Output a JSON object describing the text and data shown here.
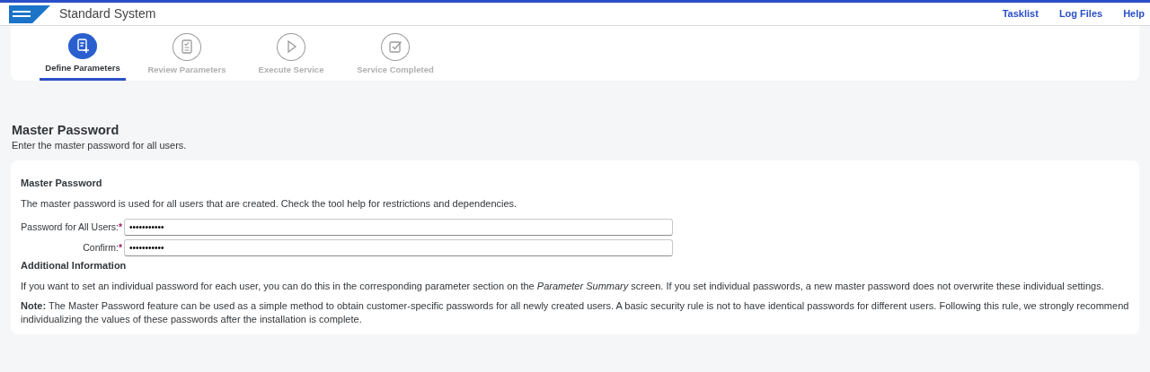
{
  "header": {
    "title": "Standard System",
    "links": [
      "Tasklist",
      "Log Files",
      "Help"
    ]
  },
  "steps": [
    {
      "label": "Define Parameters",
      "kind": "define",
      "selected": true
    },
    {
      "label": "Review Parameters",
      "kind": "review",
      "selected": false
    },
    {
      "label": "Execute Service",
      "kind": "execute",
      "selected": false
    },
    {
      "label": "Service Completed",
      "kind": "completed",
      "selected": false
    }
  ],
  "page": {
    "title": "Master Password",
    "subtitle": "Enter the master password for all users."
  },
  "section": {
    "title": "Master Password",
    "description": "The master password is used for all users that are created. Check the tool help for restrictions and dependencies.",
    "fields": [
      {
        "label": "Password for All Users:",
        "value": "•••••••••••",
        "required": true
      },
      {
        "label": "Confirm:",
        "value": "•••••••••••",
        "required": true
      }
    ],
    "required_mark": "*",
    "info_title": "Additional Information",
    "paragraphs": [
      "If you want to set an individual password for each user, you can do this in the corresponding parameter section on the *Parameter Summary* screen. If you set individual passwords, a new master password does not overwrite these individual settings.",
      "**Note:** The Master Password feature can be used as a simple method to obtain customer-specific passwords for all newly created users. A basic security rule is not to have identical passwords for different users. Following this rule, we strongly recommend individualizing the values of these passwords after the installation is complete."
    ]
  }
}
